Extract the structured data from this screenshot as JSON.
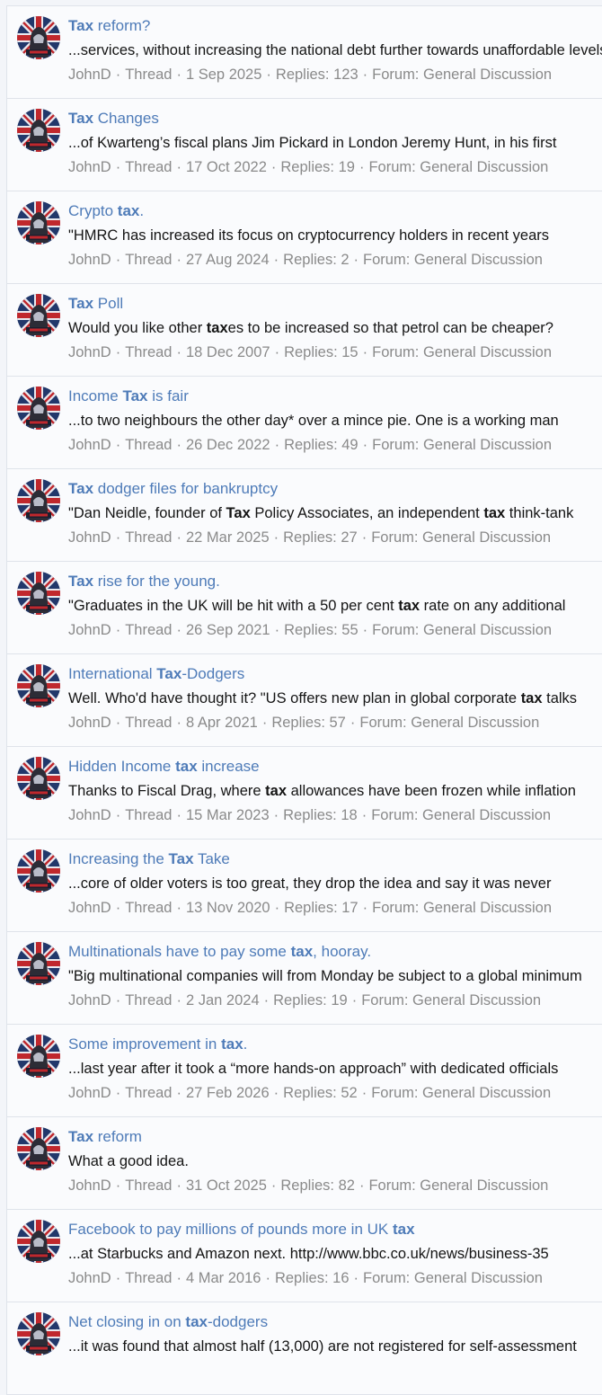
{
  "results": [
    {
      "title": "**Tax** reform?",
      "snippet": "...services, without increasing the national debt further towards unaffordable levels",
      "author": "JohnD",
      "type": "Thread",
      "date": "1 Sep 2025",
      "replies": "Replies: 123",
      "forum": "Forum: General Discussion"
    },
    {
      "title": "**Tax** Changes",
      "snippet": "...of Kwarteng’s fiscal plans Jim Pickard in London Jeremy Hunt, in his first",
      "author": "JohnD",
      "type": "Thread",
      "date": "17 Oct 2022",
      "replies": "Replies: 19",
      "forum": "Forum: General Discussion"
    },
    {
      "title": "Crypto **tax**.",
      "snippet": "\"HMRC has increased its focus on cryptocurrency holders in recent years",
      "author": "JohnD",
      "type": "Thread",
      "date": "27 Aug 2024",
      "replies": "Replies: 2",
      "forum": "Forum: General Discussion"
    },
    {
      "title": "**Tax** Poll",
      "snippet": "Would you like other **tax**es to be increased so that petrol can be cheaper?",
      "author": "JohnD",
      "type": "Thread",
      "date": "18 Dec 2007",
      "replies": "Replies: 15",
      "forum": "Forum: General Discussion"
    },
    {
      "title": "Income **Tax** is fair",
      "snippet": "...to two neighbours the other day* over a mince pie. One is a working man",
      "author": "JohnD",
      "type": "Thread",
      "date": "26 Dec 2022",
      "replies": "Replies: 49",
      "forum": "Forum: General Discussion"
    },
    {
      "title": "**Tax** dodger files for bankruptcy",
      "snippet": "\"Dan Neidle, founder of **Tax** Policy Associates, an independent **tax** think-tank",
      "author": "JohnD",
      "type": "Thread",
      "date": "22 Mar 2025",
      "replies": "Replies: 27",
      "forum": "Forum: General Discussion"
    },
    {
      "title": "**Tax** rise for the young.",
      "snippet": "\"Graduates in the UK will be hit with a 50 per cent **tax** rate on any additional",
      "author": "JohnD",
      "type": "Thread",
      "date": "26 Sep 2021",
      "replies": "Replies: 55",
      "forum": "Forum: General Discussion"
    },
    {
      "title": "International **Tax**-Dodgers",
      "snippet": "Well. Who'd have thought it? \"US offers new plan in global corporate **tax** talks",
      "author": "JohnD",
      "type": "Thread",
      "date": "8 Apr 2021",
      "replies": "Replies: 57",
      "forum": "Forum: General Discussion"
    },
    {
      "title": "Hidden Income **tax** increase",
      "snippet": "Thanks to Fiscal Drag, where **tax** allowances have been frozen while inflation",
      "author": "JohnD",
      "type": "Thread",
      "date": "15 Mar 2023",
      "replies": "Replies: 18",
      "forum": "Forum: General Discussion"
    },
    {
      "title": "Increasing the **Tax** Take",
      "snippet": "...core of older voters is too great, they drop the idea and say it was never",
      "author": "JohnD",
      "type": "Thread",
      "date": "13 Nov 2020",
      "replies": "Replies: 17",
      "forum": "Forum: General Discussion"
    },
    {
      "title": "Multinationals have to pay some **tax**, hooray.",
      "snippet": "\"Big multinational companies will from Monday be subject to a global minimum",
      "author": "JohnD",
      "type": "Thread",
      "date": "2 Jan 2024",
      "replies": "Replies: 19",
      "forum": "Forum: General Discussion"
    },
    {
      "title": "Some improvement in **tax**.",
      "snippet": "...last year after it took a “more hands-on approach” with dedicated officials",
      "author": "JohnD",
      "type": "Thread",
      "date": "27 Feb 2026",
      "replies": "Replies: 52",
      "forum": "Forum: General Discussion"
    },
    {
      "title": "**Tax** reform",
      "snippet": "What a good idea.",
      "author": "JohnD",
      "type": "Thread",
      "date": "31 Oct 2025",
      "replies": "Replies: 82",
      "forum": "Forum: General Discussion"
    },
    {
      "title": "Facebook to pay millions of pounds more in UK **tax**",
      "snippet": "...at Starbucks and Amazon next. http://www.bbc.co.uk/news/business-35",
      "author": "JohnD",
      "type": "Thread",
      "date": "4 Mar 2016",
      "replies": "Replies: 16",
      "forum": "Forum: General Discussion"
    },
    {
      "title": "Net closing in on **tax**-dodgers",
      "snippet": "...it was found that almost half (13,000) are not registered for self-assessment",
      "author": "",
      "type": "",
      "date": "",
      "replies": "",
      "forum": ""
    }
  ],
  "colors": {
    "link": "#4e7bb8",
    "text": "#141414",
    "meta": "#8a8a8a",
    "border": "#dfe3ea",
    "row_bg": "#fafbfd",
    "page_bg": "#f3f5f9"
  }
}
